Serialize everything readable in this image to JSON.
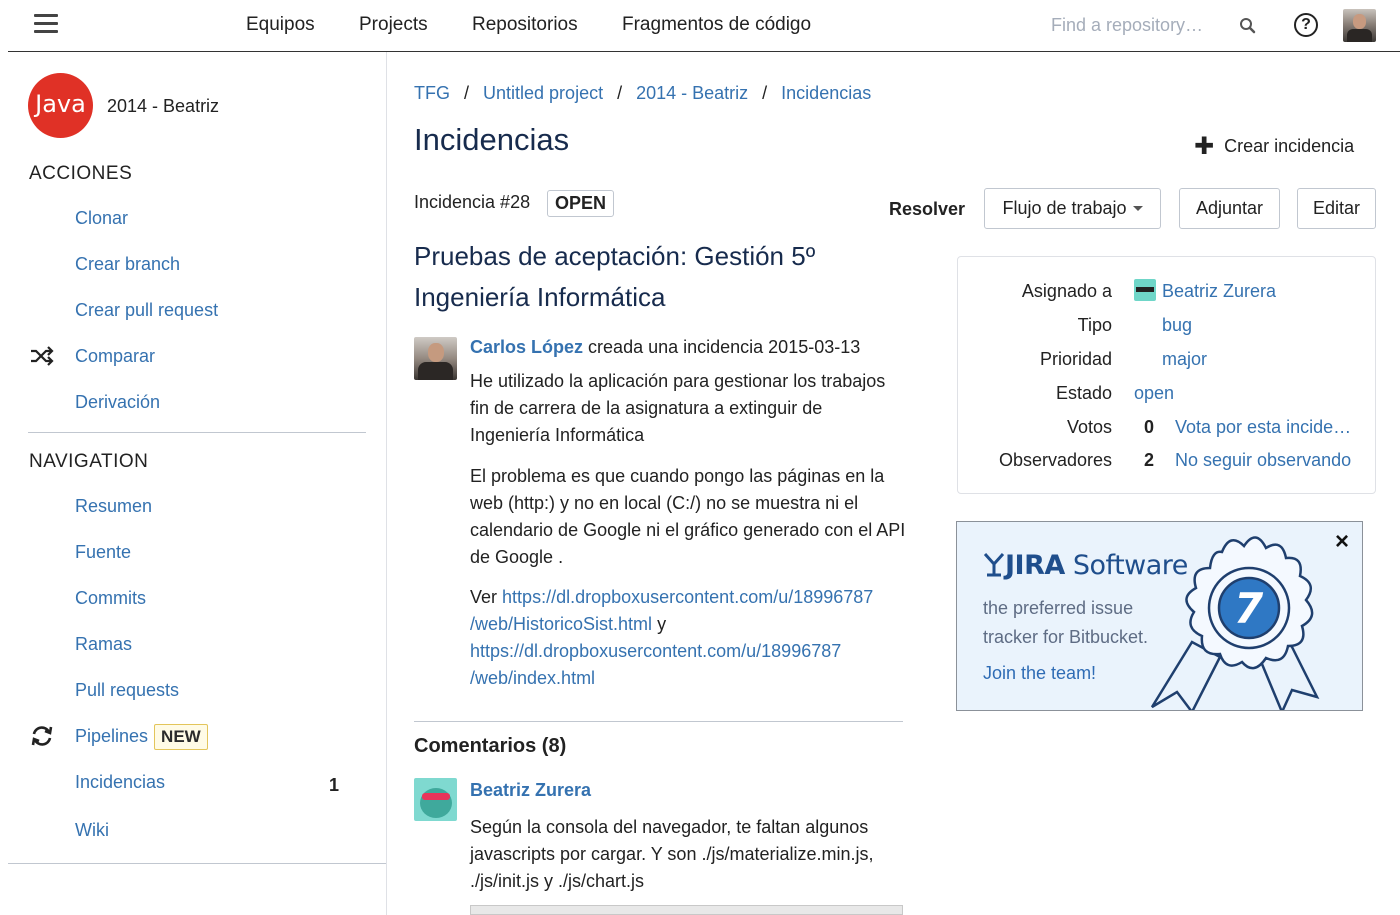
{
  "topnav": {
    "items": [
      "Equipos",
      "Projects",
      "Repositorios",
      "Fragmentos de código"
    ],
    "search_placeholder": "Find a repository…",
    "help_glyph": "?"
  },
  "sidebar": {
    "logo_text": "Java",
    "repo_name": "2014 - Beatriz",
    "actions_heading": "ACCIONES",
    "actions": [
      "Clonar",
      "Crear branch",
      "Crear pull request",
      "Comparar",
      "Derivación"
    ],
    "navigation_heading": "NAVIGATION",
    "navigation": [
      "Resumen",
      "Fuente",
      "Commits",
      "Ramas",
      "Pull requests",
      "Pipelines",
      "Incidencias",
      "Wiki"
    ],
    "pipelines_badge": "NEW",
    "incidencias_count": "1",
    "icons": {
      "compare": "shuffle-icon",
      "pipelines": "refresh-icon"
    }
  },
  "breadcrumb": [
    "TFG",
    "Untitled project",
    "2014 - Beatriz",
    "Incidencias"
  ],
  "breadcrumb_sep": "/",
  "page": {
    "title": "Incidencias",
    "create_issue": "Crear incidencia"
  },
  "issue": {
    "number": "Incidencia #28",
    "status": "OPEN",
    "resolve": "Resolver",
    "workflow": "Flujo de trabajo",
    "attach": "Adjuntar",
    "edit": "Editar",
    "title": "Pruebas de aceptación: Gestión 5º Ingeniería Informática",
    "author": "Carlos López",
    "created_text": "creada una incidencia 2015-03-13",
    "para1": "He utilizado la aplicación para gestionar los trabajos fin de carrera de la asignatura a extinguir de Ingeniería Informática",
    "para2": "El problema es que cuando pongo las páginas en la web (http:) y no en local (C:/) no se muestra ni el calendario de Google ni el gráfico generado con el API de Google .",
    "ver": "Ver",
    "link1_a": "https://dl.dropboxusercontent.com/u/18996787",
    "link1_b": "/web/HistoricoSist.html",
    "y": "y",
    "link2_a": "https://dl.dropboxusercontent.com/u/18996787",
    "link2_b": "/web/index.html"
  },
  "comments": {
    "heading": "Comentarios (8)",
    "first_author": "Beatriz Zurera",
    "first_text": "Según la consola del navegador, te faltan algunos javascripts por cargar. Y son ./js/materialize.min.js, ./js/init.js y ./js/chart.js"
  },
  "details": {
    "assigned_label": "Asignado a",
    "assigned_value": "Beatriz Zurera",
    "type_label": "Tipo",
    "type_value": "bug",
    "priority_label": "Prioridad",
    "priority_value": "major",
    "state_label": "Estado",
    "state_value": "open",
    "votes_label": "Votos",
    "votes_count": "0",
    "votes_link": "Vota por esta incide…",
    "watchers_label": "Observadores",
    "watchers_count": "2",
    "watchers_link": "No seguir observando"
  },
  "ad": {
    "brand": "JIRA",
    "brand_suffix": "Software",
    "text": "the preferred issue tracker for Bitbucket.",
    "cta": "Join the team!",
    "badge_number": "7",
    "close": "×"
  },
  "colors": {
    "link": "#3572b0",
    "java_logo": "#e03126",
    "badge_border": "#e3c55b",
    "ad_background": "#eaf3fc",
    "ad_badge_blue": "#2f78c4"
  }
}
